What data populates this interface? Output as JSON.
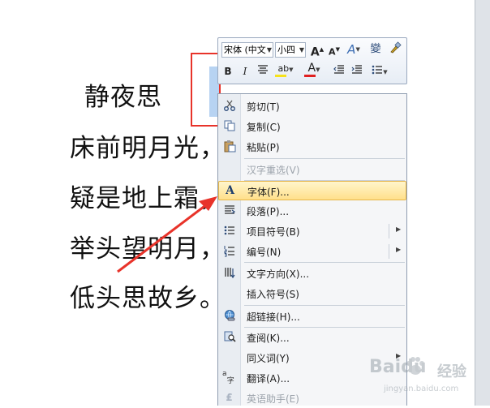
{
  "document": {
    "title": "静夜思",
    "lines": [
      "床前明月光，",
      "疑是地上霜，",
      "举头望明月，",
      "低头思故乡。"
    ]
  },
  "mini_toolbar": {
    "font_name": "宋体 (中文",
    "font_size": "小四",
    "grow_font_label": "A",
    "shrink_font_label": "A",
    "styles_label": "A",
    "phonetic_label": "變",
    "bold_label": "B",
    "italic_label": "I",
    "highlight_label": "ab",
    "font_color_label": "A",
    "highlight_color": "#f6e21c",
    "font_color": "#e02020"
  },
  "context_menu": {
    "items": [
      {
        "label": "剪切(T)",
        "icon": "scissors-icon"
      },
      {
        "label": "复制(C)",
        "icon": "copy-icon"
      },
      {
        "label": "粘贴(P)",
        "icon": "paste-icon"
      },
      {
        "label": "汉字重选(V)",
        "icon": "",
        "disabled": true
      },
      {
        "label": "字体(F)...",
        "icon": "font-icon",
        "highlighted": true
      },
      {
        "label": "段落(P)...",
        "icon": "paragraph-icon"
      },
      {
        "label": "项目符号(B)",
        "icon": "bullets-icon",
        "submenu": true
      },
      {
        "label": "编号(N)",
        "icon": "numbering-icon",
        "submenu": true
      },
      {
        "label": "文字方向(X)...",
        "icon": "text-direction-icon"
      },
      {
        "label": "插入符号(S)",
        "icon": ""
      },
      {
        "label": "超链接(H)...",
        "icon": "hyperlink-icon"
      },
      {
        "label": "查阅(K)...",
        "icon": "research-icon"
      },
      {
        "label": "同义词(Y)",
        "icon": "",
        "submenu": true
      },
      {
        "label": "翻译(A)...",
        "icon": "translate-icon"
      },
      {
        "label": "英语助手(E)",
        "icon": "english-assistant-icon",
        "disabled": true
      }
    ]
  },
  "watermark": {
    "text": "Baidu",
    "subtext": "经验",
    "url": "jingyan.baidu.com"
  },
  "colors": {
    "annotation_red": "#e8332a",
    "selection_blue": "#b7d3f2",
    "menu_highlight": "#ffe08a"
  }
}
